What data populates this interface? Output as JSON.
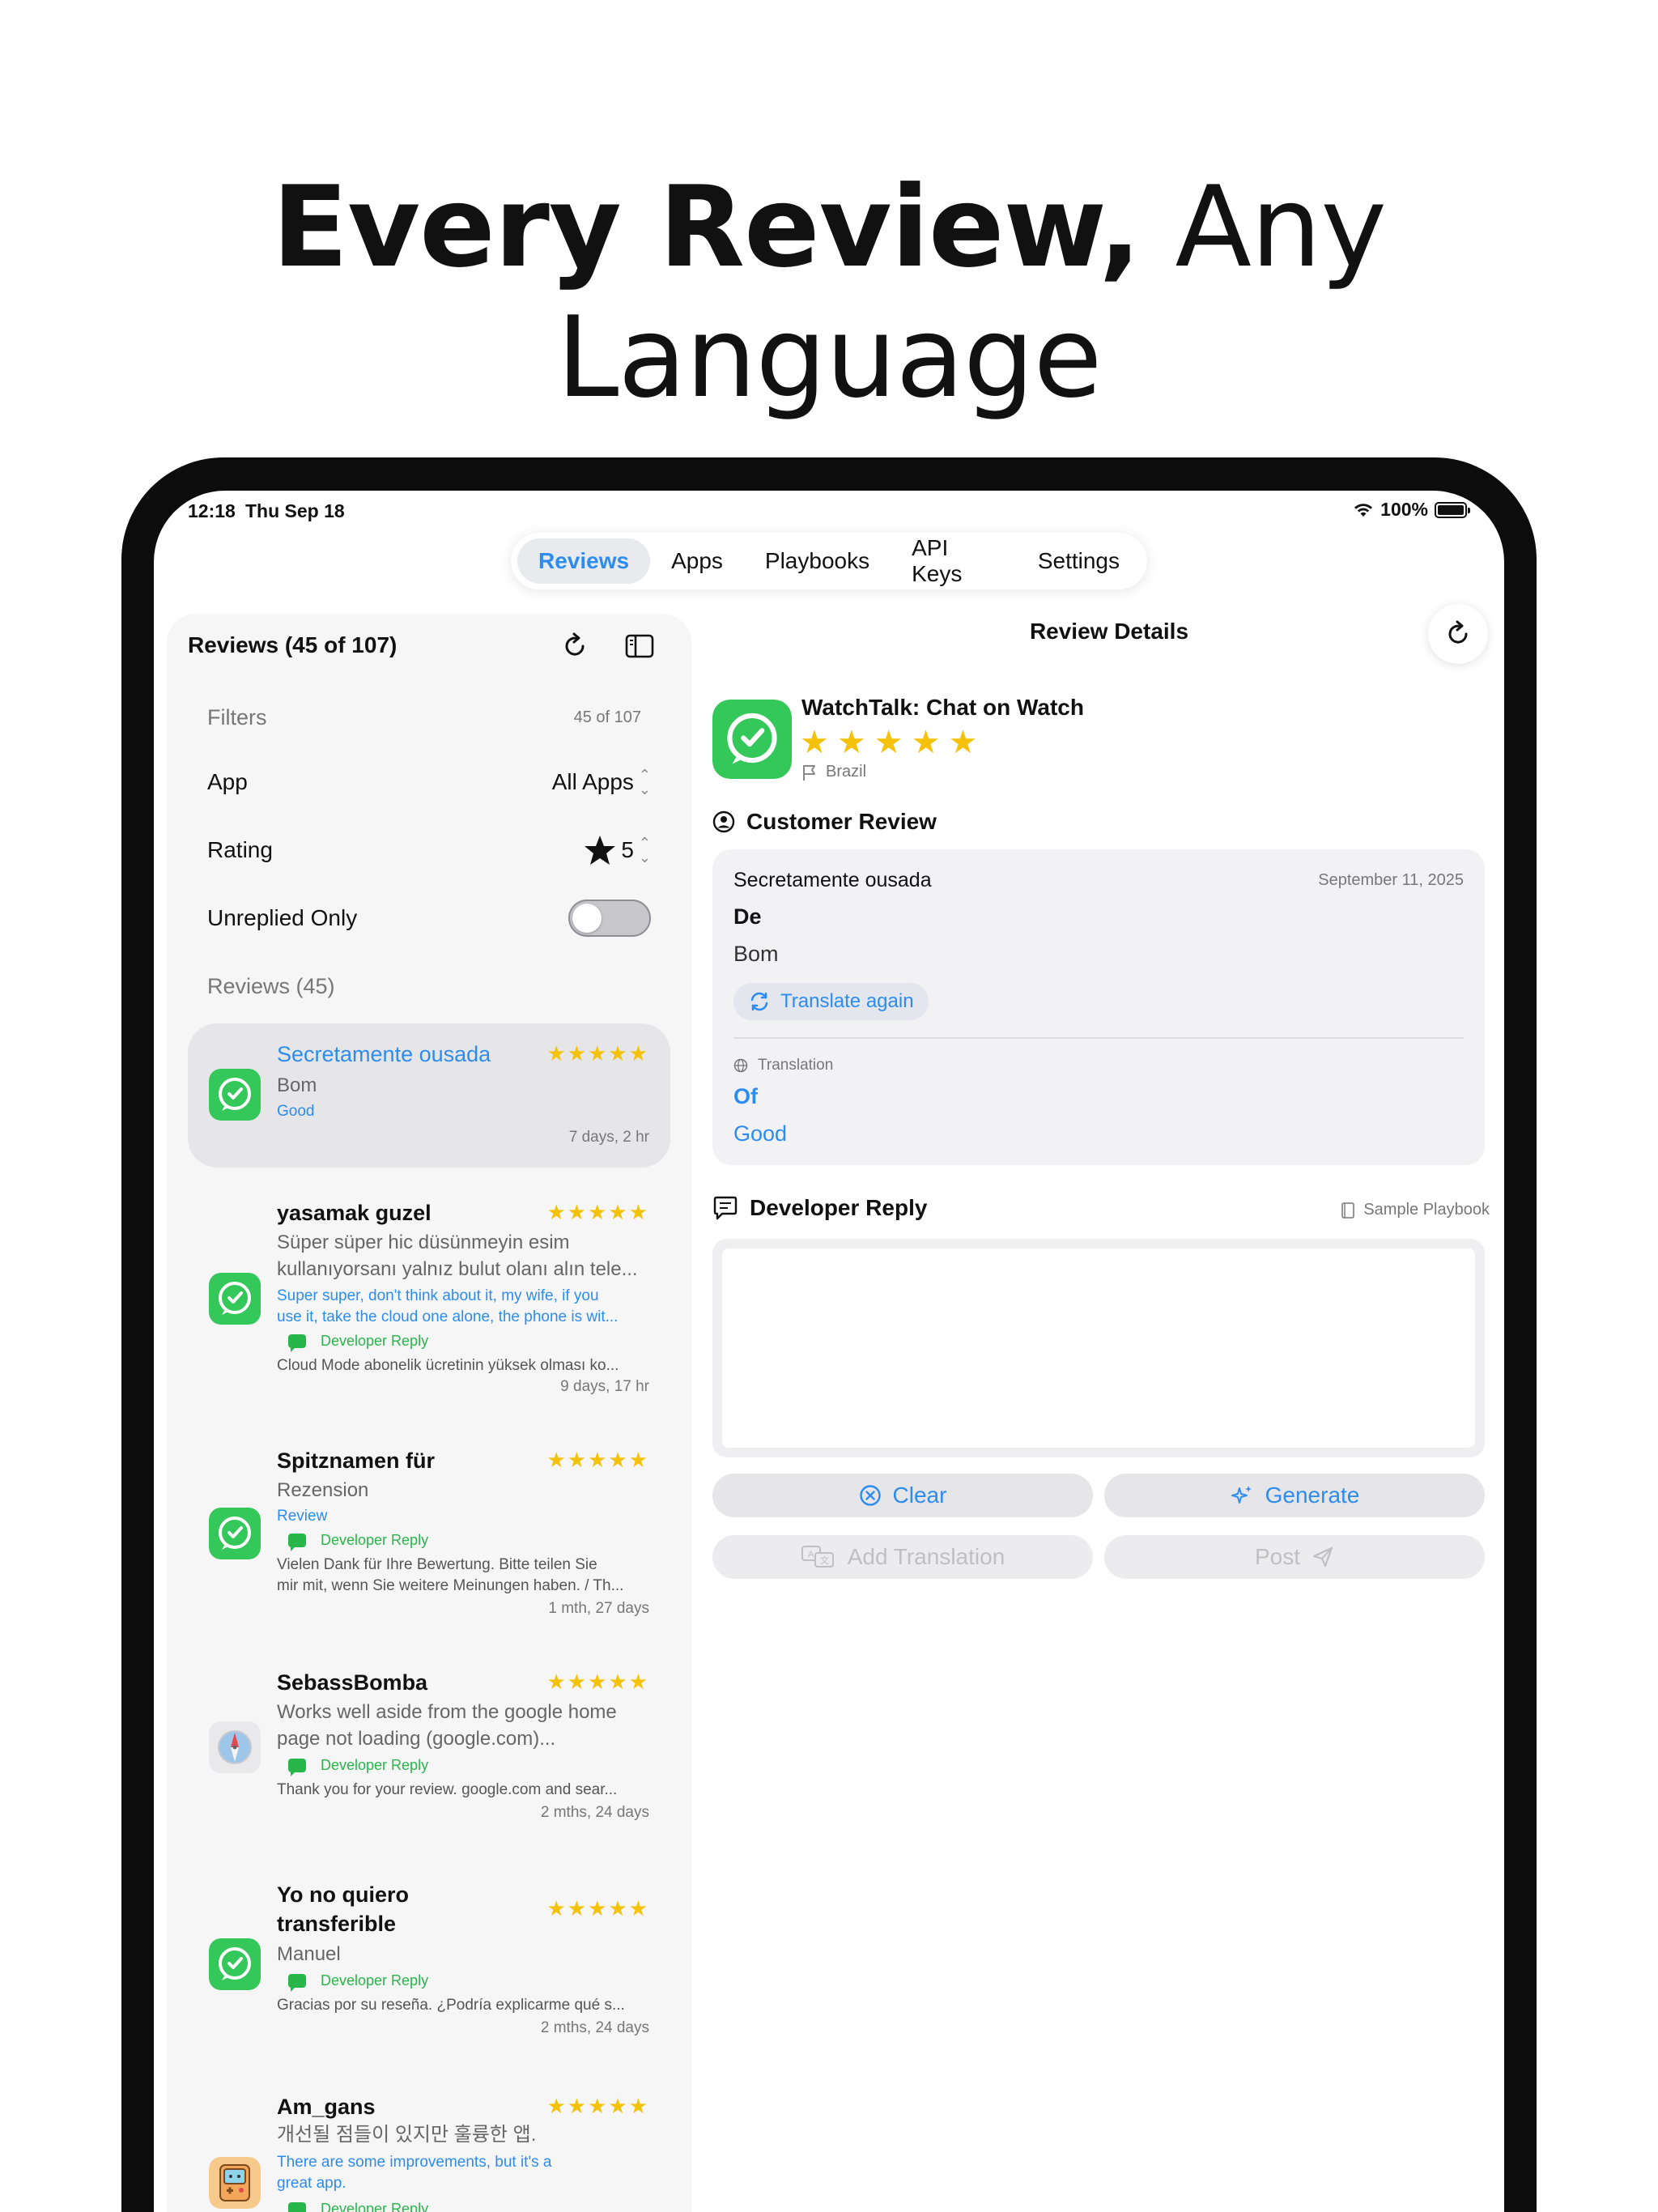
{
  "headline": {
    "bold": "Every Review,",
    "light": "Any Language"
  },
  "status": {
    "time": "12:18",
    "date": "Thu Sep 18",
    "battery": "100%"
  },
  "tabs": [
    {
      "label": "Reviews",
      "active": true
    },
    {
      "label": "Apps"
    },
    {
      "label": "Playbooks"
    },
    {
      "label": "API Keys"
    },
    {
      "label": "Settings"
    }
  ],
  "sidebar": {
    "title": "Reviews (45 of 107)",
    "filters_header": "Filters",
    "filters_count": "45 of 107",
    "app_label": "App",
    "app_value": "All Apps",
    "rating_label": "Rating",
    "rating_value": "5",
    "unreplied_label": "Unreplied Only",
    "unreplied_on": false,
    "reviews_header": "Reviews (45)",
    "reviews": [
      {
        "title": "Secretamente ousada",
        "stars": "★★★★★",
        "body": "Bom",
        "translation": "Good",
        "age": "7 days, 2 hr",
        "icon": "watch-talk-icon"
      },
      {
        "title": "yasamak guzel",
        "stars": "★★★★★",
        "body1": "Süper süper hic düsünmeyin esim",
        "body2": "kullanıyorsanı yalnız bulut olanı alın tele...",
        "trans1": "Super super, don't think about it, my wife, if you",
        "trans2": "use it, take the cloud one alone, the phone is wit...",
        "dev_label": "Developer Reply",
        "dev_text": "Cloud Mode abonelik ücretinin yüksek olması ko...",
        "age": "9 days, 17 hr",
        "icon": "watch-talk-icon"
      },
      {
        "title": "Spitznamen für",
        "stars": "★★★★★",
        "body": "Rezension",
        "translation": "Review",
        "dev_label": "Developer Reply",
        "dev_text1": "Vielen Dank für Ihre Bewertung. Bitte teilen Sie",
        "dev_text2": "mir mit, wenn Sie weitere Meinungen haben. / Th...",
        "age": "1 mth, 27 days",
        "icon": "watch-talk-icon"
      },
      {
        "title": "SebassBomba",
        "stars": "★★★★★",
        "body1": "Works well aside from the google home",
        "body2": "page not loading (google.com)...",
        "dev_label": "Developer Reply",
        "dev_text": "Thank you for your review. google.com and sear...",
        "age": "2 mths, 24 days",
        "icon": "compass-browser-icon"
      },
      {
        "title1": "Yo no quiero",
        "title2": "transferible",
        "stars": "★★★★★",
        "body": "Manuel",
        "dev_label": "Developer Reply",
        "dev_text": "Gracias por su reseña. ¿Podría explicarme qué s...",
        "age": "2 mths, 24 days",
        "icon": "watch-talk-icon"
      },
      {
        "title": "Am_gans",
        "stars": "★★★★★",
        "body": "개선될 점들이 있지만 훌륭한 앱.",
        "trans1": "There are some improvements, but it's a",
        "trans2": "great app.",
        "dev_label": "Developer Reply",
        "icon": "retro-device-icon"
      }
    ]
  },
  "detail": {
    "title": "Review Details",
    "app_name": "WatchTalk: Chat on Watch",
    "stars": "★★★★★",
    "country": "Brazil",
    "customer_review_label": "Customer Review",
    "author": "Secretamente ousada",
    "date": "September 11, 2025",
    "subject": "De",
    "text": "Bom",
    "translate_again": "Translate again",
    "translation_label": "Translation",
    "translated_subject": "Of",
    "translated_text": "Good",
    "developer_reply_label": "Developer Reply",
    "playbook": "Sample Playbook",
    "reply_text": "",
    "buttons": {
      "clear": "Clear",
      "generate": "Generate",
      "add_translation": "Add Translation",
      "post": "Post"
    }
  },
  "colors": {
    "accent": "#2d8cf0",
    "star": "#f5c20b",
    "dev_green": "#28b64a",
    "app_green": "#34c759"
  }
}
